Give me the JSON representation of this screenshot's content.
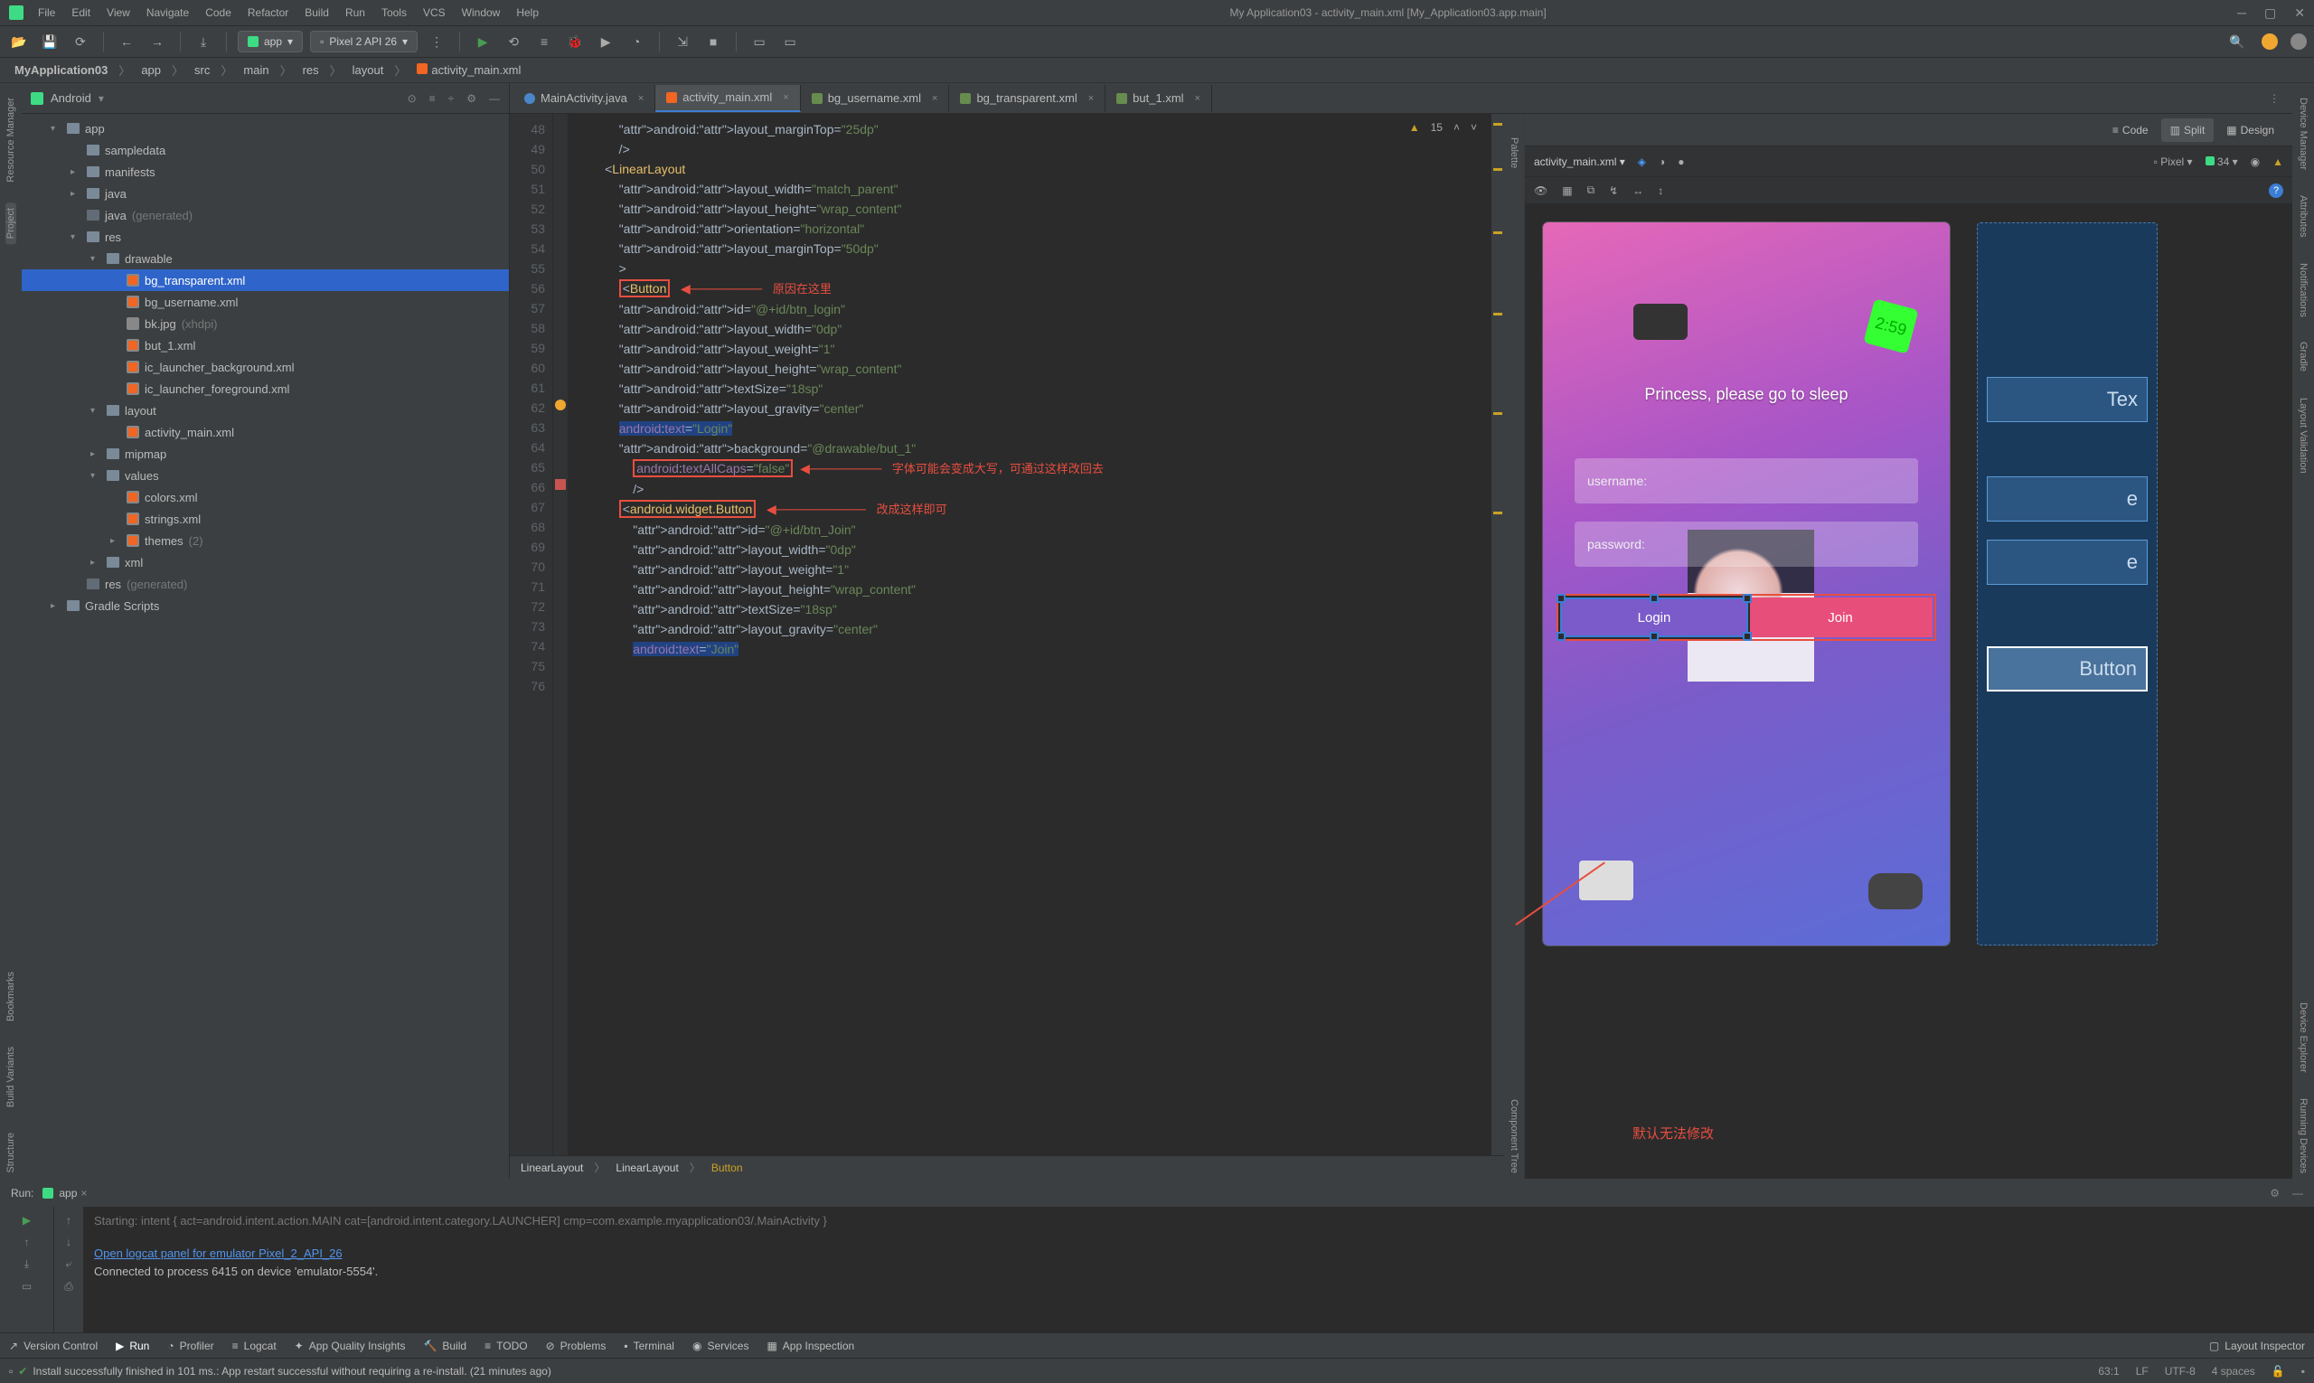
{
  "title": "My Application03 - activity_main.xml [My_Application03.app.main]",
  "menu": [
    "File",
    "Edit",
    "View",
    "Navigate",
    "Code",
    "Refactor",
    "Build",
    "Run",
    "Tools",
    "VCS",
    "Window",
    "Help"
  ],
  "toolbar": {
    "app_config": "app",
    "device": "Pixel 2 API 26"
  },
  "breadcrumb": [
    "MyApplication03",
    "app",
    "src",
    "main",
    "res",
    "layout",
    "activity_main.xml"
  ],
  "project": {
    "view": "Android",
    "root": "app",
    "tree": [
      {
        "l": 1,
        "t": "folder",
        "arr": "▾",
        "name": "app"
      },
      {
        "l": 2,
        "t": "folder",
        "arr": "",
        "name": "sampledata"
      },
      {
        "l": 2,
        "t": "folder",
        "arr": "▸",
        "name": "manifests"
      },
      {
        "l": 2,
        "t": "folder",
        "arr": "▸",
        "name": "java"
      },
      {
        "l": 2,
        "t": "folder",
        "arr": "",
        "name": "java",
        "suffix": "(generated)",
        "gen": true
      },
      {
        "l": 2,
        "t": "folder",
        "arr": "▾",
        "name": "res"
      },
      {
        "l": 3,
        "t": "folder",
        "arr": "▾",
        "name": "drawable"
      },
      {
        "l": 4,
        "t": "xml",
        "name": "bg_transparent.xml",
        "sel": true
      },
      {
        "l": 4,
        "t": "xml",
        "name": "bg_username.xml"
      },
      {
        "l": 4,
        "t": "img",
        "name": "bk.jpg",
        "suffix": "(xhdpi)"
      },
      {
        "l": 4,
        "t": "xml",
        "name": "but_1.xml"
      },
      {
        "l": 4,
        "t": "xml",
        "name": "ic_launcher_background.xml"
      },
      {
        "l": 4,
        "t": "xml",
        "name": "ic_launcher_foreground.xml"
      },
      {
        "l": 3,
        "t": "folder",
        "arr": "▾",
        "name": "layout"
      },
      {
        "l": 4,
        "t": "xml",
        "name": "activity_main.xml"
      },
      {
        "l": 3,
        "t": "folder",
        "arr": "▸",
        "name": "mipmap"
      },
      {
        "l": 3,
        "t": "folder",
        "arr": "▾",
        "name": "values"
      },
      {
        "l": 4,
        "t": "xml",
        "name": "colors.xml"
      },
      {
        "l": 4,
        "t": "xml",
        "name": "strings.xml"
      },
      {
        "l": 4,
        "t": "xml",
        "arr": "▸",
        "name": "themes",
        "suffix": "(2)"
      },
      {
        "l": 3,
        "t": "folder",
        "arr": "▸",
        "name": "xml"
      },
      {
        "l": 2,
        "t": "folder",
        "arr": "",
        "name": "res",
        "suffix": "(generated)",
        "gen": true
      },
      {
        "l": 1,
        "t": "script",
        "arr": "▸",
        "name": "Gradle Scripts"
      }
    ]
  },
  "tabs": [
    {
      "name": "MainActivity.java",
      "type": "java"
    },
    {
      "name": "activity_main.xml",
      "type": "xml",
      "active": true
    },
    {
      "name": "bg_username.xml",
      "type": "xml"
    },
    {
      "name": "bg_transparent.xml",
      "type": "xml"
    },
    {
      "name": "but_1.xml",
      "type": "xml"
    }
  ],
  "inspection": {
    "count": 15
  },
  "gutter_start": 48,
  "code_lines": [
    "            android:layout_marginTop=\"25dp\"",
    "            />",
    "",
    "        <LinearLayout",
    "            android:layout_width=\"match_parent\"",
    "            android:layout_height=\"wrap_content\"",
    "            android:orientation=\"horizontal\"",
    "            android:layout_marginTop=\"50dp\"",
    "            >",
    "            <Button",
    "            android:id=\"@+id/btn_login\"",
    "            android:layout_width=\"0dp\"",
    "            android:layout_weight=\"1\"",
    "            android:layout_height=\"wrap_content\"",
    "            android:textSize=\"18sp\"",
    "",
    "            android:layout_gravity=\"center\"",
    "            android:text=\"Login\"",
    "            android:background=\"@drawable/but_1\"",
    "                android:textAllCaps=\"false\"",
    "                />",
    "            <android.widget.Button",
    "                android:id=\"@+id/btn_Join\"",
    "                android:layout_width=\"0dp\"",
    "                android:layout_weight=\"1\"",
    "                android:layout_height=\"wrap_content\"",
    "                android:textSize=\"18sp\"",
    "                android:layout_gravity=\"center\"",
    "                android:text=\"Join\""
  ],
  "annotations": {
    "a1": "原因在这里",
    "a2": "字体可能会变成大写，可通过这样改回去",
    "a3": "改成这样即可",
    "a4": "默认无法修改"
  },
  "pathbar": [
    "LinearLayout",
    "LinearLayout",
    "Button"
  ],
  "view_modes": [
    "Code",
    "Split",
    "Design"
  ],
  "preview": {
    "file": "activity_main.xml",
    "device": "Pixel",
    "api": "34",
    "title": "Princess, please go to sleep",
    "user_ph": "username:",
    "pass_ph": "password:",
    "login": "Login",
    "join": "Join",
    "bp_text": "Tex",
    "bp_e": "e",
    "bp_button": "Button"
  },
  "run": {
    "title": "Run:",
    "config": "app",
    "line1_grey": "Starting: intent { act=android.intent.action.MAIN cat=[android.intent.category.LAUNCHER] cmp=com.example.myapplication03/.MainActivity }",
    "line2_link": "Open logcat panel for emulator Pixel_2_API_26",
    "line3": "Connected to process 6415 on device 'emulator-5554'."
  },
  "bottom_items": [
    "Version Control",
    "Run",
    "Profiler",
    "Logcat",
    "App Quality Insights",
    "Build",
    "TODO",
    "Problems",
    "Terminal",
    "Services",
    "App Inspection"
  ],
  "bottom_right": "Layout Inspector",
  "status": {
    "msg": "Install successfully finished in 101 ms.: App restart successful without requiring a re-install. (21 minutes ago)",
    "pos": "63:1",
    "lf": "LF",
    "enc": "UTF-8",
    "indent": "4 spaces"
  },
  "side_tabs_left": [
    "Resource Manager",
    "Project",
    "Bookmarks",
    "Build Variants",
    "Structure"
  ],
  "side_tabs_right": [
    "Device Manager",
    "Attributes",
    "Notifications",
    "Gradle",
    "Layout Validation",
    "Device Explorer",
    "Running Devices"
  ],
  "mid_tabs": [
    "Palette",
    "Component Tree"
  ]
}
